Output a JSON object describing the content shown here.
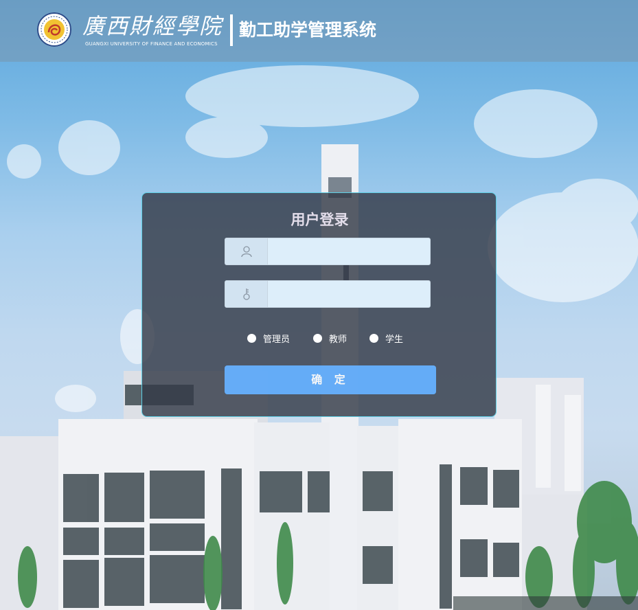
{
  "header": {
    "school_name_cn": "廣西財經學院",
    "school_name_en": "GUANGXI UNIVERSITY OF FINANCE AND ECONOMICS",
    "system_title": "勤工助学管理系统"
  },
  "login": {
    "title": "用户登录",
    "username_placeholder": "",
    "password_placeholder": "",
    "icons": {
      "username": "user-icon",
      "password": "key-icon"
    },
    "roles": [
      "管理员",
      "教师",
      "学生"
    ],
    "submit_label": "确 定"
  },
  "colors": {
    "panel_border": "#5fd0e6",
    "submit_button": "#66b1ff",
    "panel_bg": "#343a48"
  }
}
